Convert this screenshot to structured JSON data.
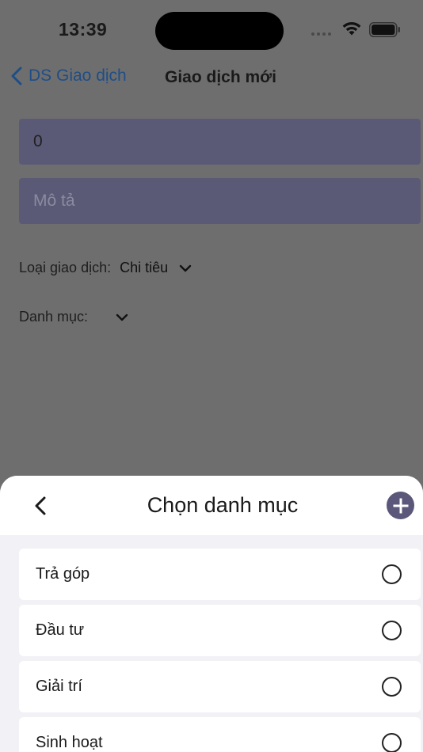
{
  "status": {
    "time": "13:39"
  },
  "nav": {
    "back_label": "DS Giao dịch",
    "title": "Giao dịch mới"
  },
  "form": {
    "amount_value": "0",
    "description_placeholder": "Mô tả",
    "type_label": "Loại giao dịch:",
    "type_value": "Chi tiêu",
    "category_label": "Danh mục:",
    "category_value": ""
  },
  "sheet": {
    "title": "Chọn danh mục",
    "categories": [
      {
        "label": "Trả góp",
        "selected": false
      },
      {
        "label": "Đầu tư",
        "selected": false
      },
      {
        "label": "Giải trí",
        "selected": false
      },
      {
        "label": "Sinh hoạt",
        "selected": false
      }
    ]
  },
  "colors": {
    "accent": "#5a577a",
    "link": "#1f4e86",
    "overlay": "#6e6e6f",
    "field": "#5b5a76"
  },
  "icons": [
    "back-chevron-icon",
    "chevron-down-icon",
    "plus-icon",
    "radio-icon",
    "wifi-icon",
    "battery-icon"
  ]
}
